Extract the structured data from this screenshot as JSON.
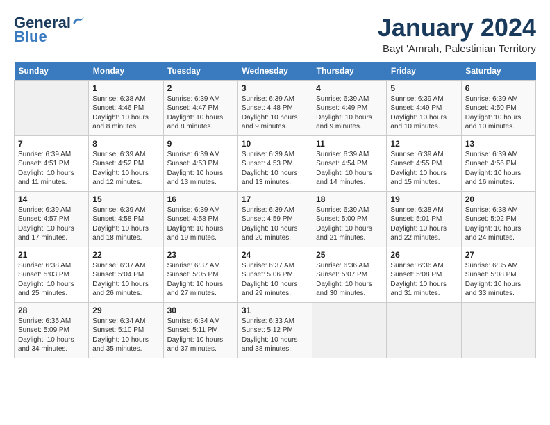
{
  "header": {
    "logo_line1": "General",
    "logo_line2": "Blue",
    "month": "January 2024",
    "location": "Bayt 'Amrah, Palestinian Territory"
  },
  "days_of_week": [
    "Sunday",
    "Monday",
    "Tuesday",
    "Wednesday",
    "Thursday",
    "Friday",
    "Saturday"
  ],
  "weeks": [
    [
      {
        "day": "",
        "sunrise": "",
        "sunset": "",
        "daylight": ""
      },
      {
        "day": "1",
        "sunrise": "Sunrise: 6:38 AM",
        "sunset": "Sunset: 4:46 PM",
        "daylight": "Daylight: 10 hours and 8 minutes."
      },
      {
        "day": "2",
        "sunrise": "Sunrise: 6:39 AM",
        "sunset": "Sunset: 4:47 PM",
        "daylight": "Daylight: 10 hours and 8 minutes."
      },
      {
        "day": "3",
        "sunrise": "Sunrise: 6:39 AM",
        "sunset": "Sunset: 4:48 PM",
        "daylight": "Daylight: 10 hours and 9 minutes."
      },
      {
        "day": "4",
        "sunrise": "Sunrise: 6:39 AM",
        "sunset": "Sunset: 4:49 PM",
        "daylight": "Daylight: 10 hours and 9 minutes."
      },
      {
        "day": "5",
        "sunrise": "Sunrise: 6:39 AM",
        "sunset": "Sunset: 4:49 PM",
        "daylight": "Daylight: 10 hours and 10 minutes."
      },
      {
        "day": "6",
        "sunrise": "Sunrise: 6:39 AM",
        "sunset": "Sunset: 4:50 PM",
        "daylight": "Daylight: 10 hours and 10 minutes."
      }
    ],
    [
      {
        "day": "7",
        "sunrise": "Sunrise: 6:39 AM",
        "sunset": "Sunset: 4:51 PM",
        "daylight": "Daylight: 10 hours and 11 minutes."
      },
      {
        "day": "8",
        "sunrise": "Sunrise: 6:39 AM",
        "sunset": "Sunset: 4:52 PM",
        "daylight": "Daylight: 10 hours and 12 minutes."
      },
      {
        "day": "9",
        "sunrise": "Sunrise: 6:39 AM",
        "sunset": "Sunset: 4:53 PM",
        "daylight": "Daylight: 10 hours and 13 minutes."
      },
      {
        "day": "10",
        "sunrise": "Sunrise: 6:39 AM",
        "sunset": "Sunset: 4:53 PM",
        "daylight": "Daylight: 10 hours and 13 minutes."
      },
      {
        "day": "11",
        "sunrise": "Sunrise: 6:39 AM",
        "sunset": "Sunset: 4:54 PM",
        "daylight": "Daylight: 10 hours and 14 minutes."
      },
      {
        "day": "12",
        "sunrise": "Sunrise: 6:39 AM",
        "sunset": "Sunset: 4:55 PM",
        "daylight": "Daylight: 10 hours and 15 minutes."
      },
      {
        "day": "13",
        "sunrise": "Sunrise: 6:39 AM",
        "sunset": "Sunset: 4:56 PM",
        "daylight": "Daylight: 10 hours and 16 minutes."
      }
    ],
    [
      {
        "day": "14",
        "sunrise": "Sunrise: 6:39 AM",
        "sunset": "Sunset: 4:57 PM",
        "daylight": "Daylight: 10 hours and 17 minutes."
      },
      {
        "day": "15",
        "sunrise": "Sunrise: 6:39 AM",
        "sunset": "Sunset: 4:58 PM",
        "daylight": "Daylight: 10 hours and 18 minutes."
      },
      {
        "day": "16",
        "sunrise": "Sunrise: 6:39 AM",
        "sunset": "Sunset: 4:58 PM",
        "daylight": "Daylight: 10 hours and 19 minutes."
      },
      {
        "day": "17",
        "sunrise": "Sunrise: 6:39 AM",
        "sunset": "Sunset: 4:59 PM",
        "daylight": "Daylight: 10 hours and 20 minutes."
      },
      {
        "day": "18",
        "sunrise": "Sunrise: 6:39 AM",
        "sunset": "Sunset: 5:00 PM",
        "daylight": "Daylight: 10 hours and 21 minutes."
      },
      {
        "day": "19",
        "sunrise": "Sunrise: 6:38 AM",
        "sunset": "Sunset: 5:01 PM",
        "daylight": "Daylight: 10 hours and 22 minutes."
      },
      {
        "day": "20",
        "sunrise": "Sunrise: 6:38 AM",
        "sunset": "Sunset: 5:02 PM",
        "daylight": "Daylight: 10 hours and 24 minutes."
      }
    ],
    [
      {
        "day": "21",
        "sunrise": "Sunrise: 6:38 AM",
        "sunset": "Sunset: 5:03 PM",
        "daylight": "Daylight: 10 hours and 25 minutes."
      },
      {
        "day": "22",
        "sunrise": "Sunrise: 6:37 AM",
        "sunset": "Sunset: 5:04 PM",
        "daylight": "Daylight: 10 hours and 26 minutes."
      },
      {
        "day": "23",
        "sunrise": "Sunrise: 6:37 AM",
        "sunset": "Sunset: 5:05 PM",
        "daylight": "Daylight: 10 hours and 27 minutes."
      },
      {
        "day": "24",
        "sunrise": "Sunrise: 6:37 AM",
        "sunset": "Sunset: 5:06 PM",
        "daylight": "Daylight: 10 hours and 29 minutes."
      },
      {
        "day": "25",
        "sunrise": "Sunrise: 6:36 AM",
        "sunset": "Sunset: 5:07 PM",
        "daylight": "Daylight: 10 hours and 30 minutes."
      },
      {
        "day": "26",
        "sunrise": "Sunrise: 6:36 AM",
        "sunset": "Sunset: 5:08 PM",
        "daylight": "Daylight: 10 hours and 31 minutes."
      },
      {
        "day": "27",
        "sunrise": "Sunrise: 6:35 AM",
        "sunset": "Sunset: 5:08 PM",
        "daylight": "Daylight: 10 hours and 33 minutes."
      }
    ],
    [
      {
        "day": "28",
        "sunrise": "Sunrise: 6:35 AM",
        "sunset": "Sunset: 5:09 PM",
        "daylight": "Daylight: 10 hours and 34 minutes."
      },
      {
        "day": "29",
        "sunrise": "Sunrise: 6:34 AM",
        "sunset": "Sunset: 5:10 PM",
        "daylight": "Daylight: 10 hours and 35 minutes."
      },
      {
        "day": "30",
        "sunrise": "Sunrise: 6:34 AM",
        "sunset": "Sunset: 5:11 PM",
        "daylight": "Daylight: 10 hours and 37 minutes."
      },
      {
        "day": "31",
        "sunrise": "Sunrise: 6:33 AM",
        "sunset": "Sunset: 5:12 PM",
        "daylight": "Daylight: 10 hours and 38 minutes."
      },
      {
        "day": "",
        "sunrise": "",
        "sunset": "",
        "daylight": ""
      },
      {
        "day": "",
        "sunrise": "",
        "sunset": "",
        "daylight": ""
      },
      {
        "day": "",
        "sunrise": "",
        "sunset": "",
        "daylight": ""
      }
    ]
  ]
}
